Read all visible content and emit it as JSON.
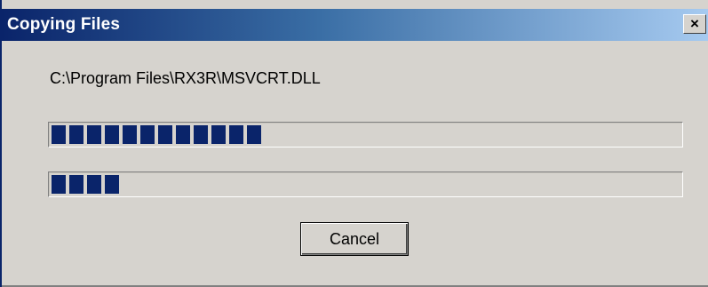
{
  "window": {
    "title": "Copying Files",
    "close_glyph": "×",
    "close_icon": "close-icon"
  },
  "current_file": "C:\\Program Files\\RX3R\\MSVCRT.DLL",
  "progress": {
    "overall_fraction": 0.33,
    "file_fraction": 0.11,
    "fill_color": "#0a246a"
  },
  "buttons": {
    "cancel_label": "Cancel"
  }
}
